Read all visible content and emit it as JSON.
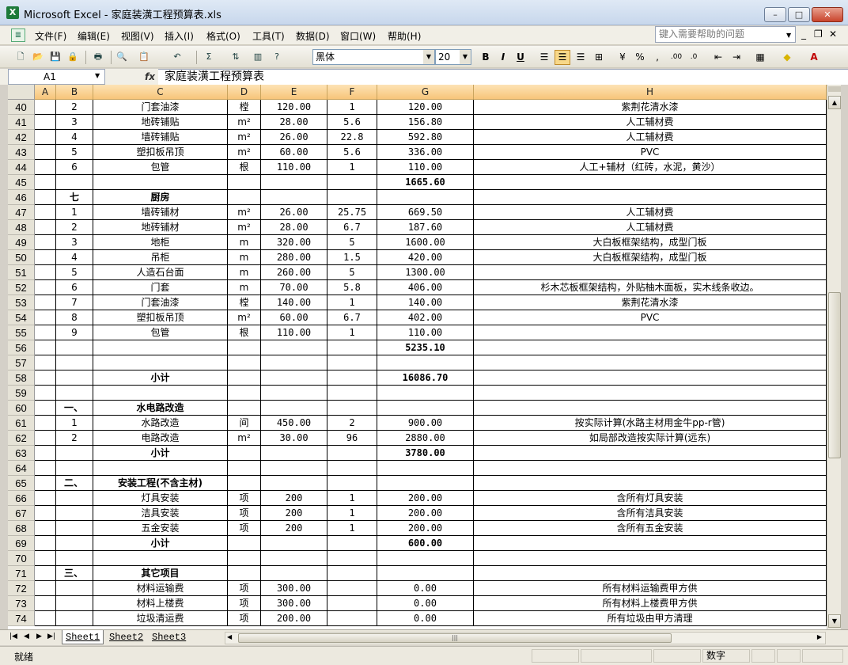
{
  "window": {
    "title": "Microsoft Excel - 家庭装潢工程预算表.xls",
    "app_icon_label": "X",
    "min_glyph": "–",
    "max_glyph": "□",
    "close_glyph": "✕"
  },
  "menu": {
    "items": [
      "文件(F)",
      "编辑(E)",
      "视图(V)",
      "插入(I)",
      "格式(O)",
      "工具(T)",
      "数据(D)",
      "窗口(W)",
      "帮助(H)"
    ],
    "help_placeholder": "键入需要帮助的问题",
    "mdi_min": "_",
    "mdi_restore": "❐",
    "mdi_close": "✕"
  },
  "toolbar": {
    "font_name": "黑体",
    "font_size": "20",
    "bold": "B",
    "italic": "I",
    "underline": "U",
    "percent": "%",
    "comma": ",",
    "sum": "Σ"
  },
  "formula": {
    "name_box": "A1",
    "fx": "fx",
    "content": "家庭装潢工程预算表"
  },
  "columns": [
    "A",
    "B",
    "C",
    "D",
    "E",
    "F",
    "G",
    "H"
  ],
  "rows": [
    {
      "n": "40",
      "b": "2",
      "c": "门套油漆",
      "d": "樘",
      "e": "120.00",
      "f": "1",
      "g": "120.00",
      "h": "紫荆花清水漆"
    },
    {
      "n": "41",
      "b": "3",
      "c": "地砖铺贴",
      "d": "m²",
      "e": "28.00",
      "f": "5.6",
      "g": "156.80",
      "h": "人工辅材费"
    },
    {
      "n": "42",
      "b": "4",
      "c": "墙砖铺贴",
      "d": "m²",
      "e": "26.00",
      "f": "22.8",
      "g": "592.80",
      "h": "人工辅材费"
    },
    {
      "n": "43",
      "b": "5",
      "c": "塑扣板吊顶",
      "d": "m²",
      "e": "60.00",
      "f": "5.6",
      "g": "336.00",
      "h": "PVC"
    },
    {
      "n": "44",
      "b": "6",
      "c": "包管",
      "d": "根",
      "e": "110.00",
      "f": "1",
      "g": "110.00",
      "h": "人工+辅材（红砖，水泥，黄沙）"
    },
    {
      "n": "45",
      "b": "",
      "c": "",
      "d": "",
      "e": "",
      "f": "",
      "g": "1665.60",
      "h": "",
      "gbold": true
    },
    {
      "n": "46",
      "b": "七",
      "c": "厨房",
      "d": "",
      "e": "",
      "f": "",
      "g": "",
      "h": "",
      "bbold": true,
      "cbold": true
    },
    {
      "n": "47",
      "b": "1",
      "c": "墙砖铺材",
      "d": "m²",
      "e": "26.00",
      "f": "25.75",
      "g": "669.50",
      "h": "人工辅材费"
    },
    {
      "n": "48",
      "b": "2",
      "c": "地砖铺材",
      "d": "m²",
      "e": "28.00",
      "f": "6.7",
      "g": "187.60",
      "h": "人工辅材费"
    },
    {
      "n": "49",
      "b": "3",
      "c": "地柜",
      "d": "m",
      "e": "320.00",
      "f": "5",
      "g": "1600.00",
      "h": "大白板框架结构，成型门板"
    },
    {
      "n": "50",
      "b": "4",
      "c": "吊柜",
      "d": "m",
      "e": "280.00",
      "f": "1.5",
      "g": "420.00",
      "h": "大白板框架结构，成型门板"
    },
    {
      "n": "51",
      "b": "5",
      "c": "人造石台面",
      "d": "m",
      "e": "260.00",
      "f": "5",
      "g": "1300.00",
      "h": ""
    },
    {
      "n": "52",
      "b": "6",
      "c": "门套",
      "d": "m",
      "e": "70.00",
      "f": "5.8",
      "g": "406.00",
      "h": "杉木芯板框架结构，外贴柚木面板，实木线条收边。"
    },
    {
      "n": "53",
      "b": "7",
      "c": "门套油漆",
      "d": "樘",
      "e": "140.00",
      "f": "1",
      "g": "140.00",
      "h": "紫荆花清水漆"
    },
    {
      "n": "54",
      "b": "8",
      "c": "塑扣板吊顶",
      "d": "m²",
      "e": "60.00",
      "f": "6.7",
      "g": "402.00",
      "h": "PVC"
    },
    {
      "n": "55",
      "b": "9",
      "c": "包管",
      "d": "根",
      "e": "110.00",
      "f": "1",
      "g": "110.00",
      "h": ""
    },
    {
      "n": "56",
      "b": "",
      "c": "",
      "d": "",
      "e": "",
      "f": "",
      "g": "5235.10",
      "h": "",
      "gbold": true
    },
    {
      "n": "57",
      "b": "",
      "c": "",
      "d": "",
      "e": "",
      "f": "",
      "g": "",
      "h": ""
    },
    {
      "n": "58",
      "b": "",
      "c": "小计",
      "d": "",
      "e": "",
      "f": "",
      "g": "16086.70",
      "h": "",
      "cbold": true,
      "gbold": true
    },
    {
      "n": "59",
      "b": "",
      "c": "",
      "d": "",
      "e": "",
      "f": "",
      "g": "",
      "h": ""
    },
    {
      "n": "60",
      "b": "一、",
      "c": "水电路改造",
      "d": "",
      "e": "",
      "f": "",
      "g": "",
      "h": "",
      "bbold": true,
      "cbold": true
    },
    {
      "n": "61",
      "b": "1",
      "c": "水路改造",
      "d": "间",
      "e": "450.00",
      "f": "2",
      "g": "900.00",
      "h": "按实际计算(水路主材用金牛pp-r管)"
    },
    {
      "n": "62",
      "b": "2",
      "c": "电路改造",
      "d": "m²",
      "e": "30.00",
      "f": "96",
      "g": "2880.00",
      "h": "如局部改造按实际计算(远东)"
    },
    {
      "n": "63",
      "b": "",
      "c": "小计",
      "d": "",
      "e": "",
      "f": "",
      "g": "3780.00",
      "h": "",
      "cbold": true,
      "gbold": true
    },
    {
      "n": "64",
      "b": "",
      "c": "",
      "d": "",
      "e": "",
      "f": "",
      "g": "",
      "h": ""
    },
    {
      "n": "65",
      "b": "二、",
      "c": "安装工程(不含主材)",
      "d": "",
      "e": "",
      "f": "",
      "g": "",
      "h": "",
      "bbold": true,
      "cbold": true
    },
    {
      "n": "66",
      "b": "",
      "c": "灯具安装",
      "d": "项",
      "e": "200",
      "f": "1",
      "g": "200.00",
      "h": "含所有灯具安装"
    },
    {
      "n": "67",
      "b": "",
      "c": "洁具安装",
      "d": "项",
      "e": "200",
      "f": "1",
      "g": "200.00",
      "h": "含所有洁具安装"
    },
    {
      "n": "68",
      "b": "",
      "c": "五金安装",
      "d": "项",
      "e": "200",
      "f": "1",
      "g": "200.00",
      "h": "含所有五金安装"
    },
    {
      "n": "69",
      "b": "",
      "c": "小计",
      "d": "",
      "e": "",
      "f": "",
      "g": "600.00",
      "h": "",
      "cbold": true,
      "gbold": true
    },
    {
      "n": "70",
      "b": "",
      "c": "",
      "d": "",
      "e": "",
      "f": "",
      "g": "",
      "h": ""
    },
    {
      "n": "71",
      "b": "三、",
      "c": "其它项目",
      "d": "",
      "e": "",
      "f": "",
      "g": "",
      "h": "",
      "bbold": true,
      "cbold": true
    },
    {
      "n": "72",
      "b": "",
      "c": "材料运输费",
      "d": "项",
      "e": "300.00",
      "f": "",
      "g": "0.00",
      "h": "所有材料运输费甲方供"
    },
    {
      "n": "73",
      "b": "",
      "c": "材料上楼费",
      "d": "项",
      "e": "300.00",
      "f": "",
      "g": "0.00",
      "h": "所有材料上楼费甲方供"
    },
    {
      "n": "74",
      "b": "",
      "c": "垃圾清运费",
      "d": "项",
      "e": "200.00",
      "f": "",
      "g": "0.00",
      "h": "所有垃圾由甲方清理"
    }
  ],
  "sheets": [
    "Sheet1",
    "Sheet2",
    "Sheet3"
  ],
  "active_sheet": "Sheet1",
  "status": {
    "left": "就绪",
    "mode": "数字"
  },
  "colors": {
    "column_header": "#f7c57a",
    "selected_button": "#f8d889",
    "title_bar": "#c7d7ec"
  }
}
